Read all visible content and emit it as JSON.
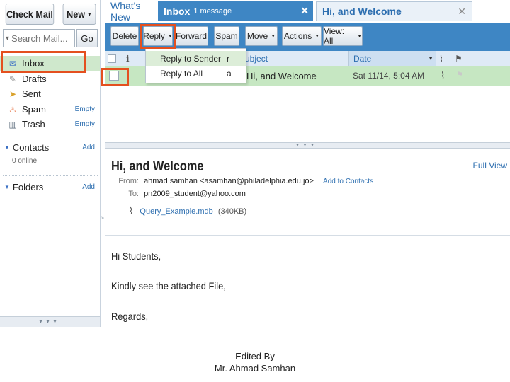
{
  "sidebar": {
    "check_mail": "Check Mail",
    "new_button": "New",
    "search_placeholder": "Search Mail...",
    "go_button": "Go",
    "folders": [
      {
        "label": "Inbox",
        "icon": "inbox-icon",
        "action": ""
      },
      {
        "label": "Drafts",
        "icon": "drafts-icon",
        "action": ""
      },
      {
        "label": "Sent",
        "icon": "sent-icon",
        "action": ""
      },
      {
        "label": "Spam",
        "icon": "spam-icon",
        "action": "Empty"
      },
      {
        "label": "Trash",
        "icon": "trash-icon",
        "action": "Empty"
      }
    ],
    "contacts": {
      "label": "Contacts",
      "action": "Add",
      "status": "0 online"
    },
    "folders_section": {
      "label": "Folders",
      "action": "Add"
    }
  },
  "tabs": [
    {
      "label": "What's New"
    },
    {
      "label": "Inbox",
      "count": "1 message"
    },
    {
      "label": "Hi, and Welcome"
    }
  ],
  "toolbar": {
    "delete": "Delete",
    "reply": "Reply",
    "forward": "Forward",
    "spam": "Spam",
    "move": "Move",
    "actions": "Actions",
    "view": "View: All"
  },
  "reply_menu": [
    {
      "label": "Reply to Sender",
      "key": "r"
    },
    {
      "label": "Reply to All",
      "key": "a"
    }
  ],
  "list": {
    "headers": {
      "subject": "Subject",
      "date": "Date"
    },
    "rows": [
      {
        "subject": "Hi, and Welcome",
        "date": "Sat 11/14, 5:04 AM",
        "has_attachment": true
      }
    ]
  },
  "message": {
    "title": "Hi, and Welcome",
    "full_view": "Full View",
    "from_label": "From:",
    "from_name": "ahmad samhan",
    "from_email": "<asamhan@philadelphia.edu.jo>",
    "add_to_contacts": "Add to Contacts",
    "to_label": "To:",
    "to": "pn2009_student@yahoo.com",
    "attachment": {
      "name": "Query_Example.mdb",
      "size": "(340KB)"
    },
    "body": [
      "Hi Students,",
      "Kindly see the attached File,",
      "Regards,"
    ]
  },
  "caption": {
    "line1": "Edited By",
    "line2": "Mr. Ahmad Samhan"
  },
  "colors": {
    "toolbar_blue": "#3e86c4",
    "selected_row_green": "#c6e7c2",
    "highlight_red": "#e4501f",
    "link_blue": "#2e6fb0"
  }
}
